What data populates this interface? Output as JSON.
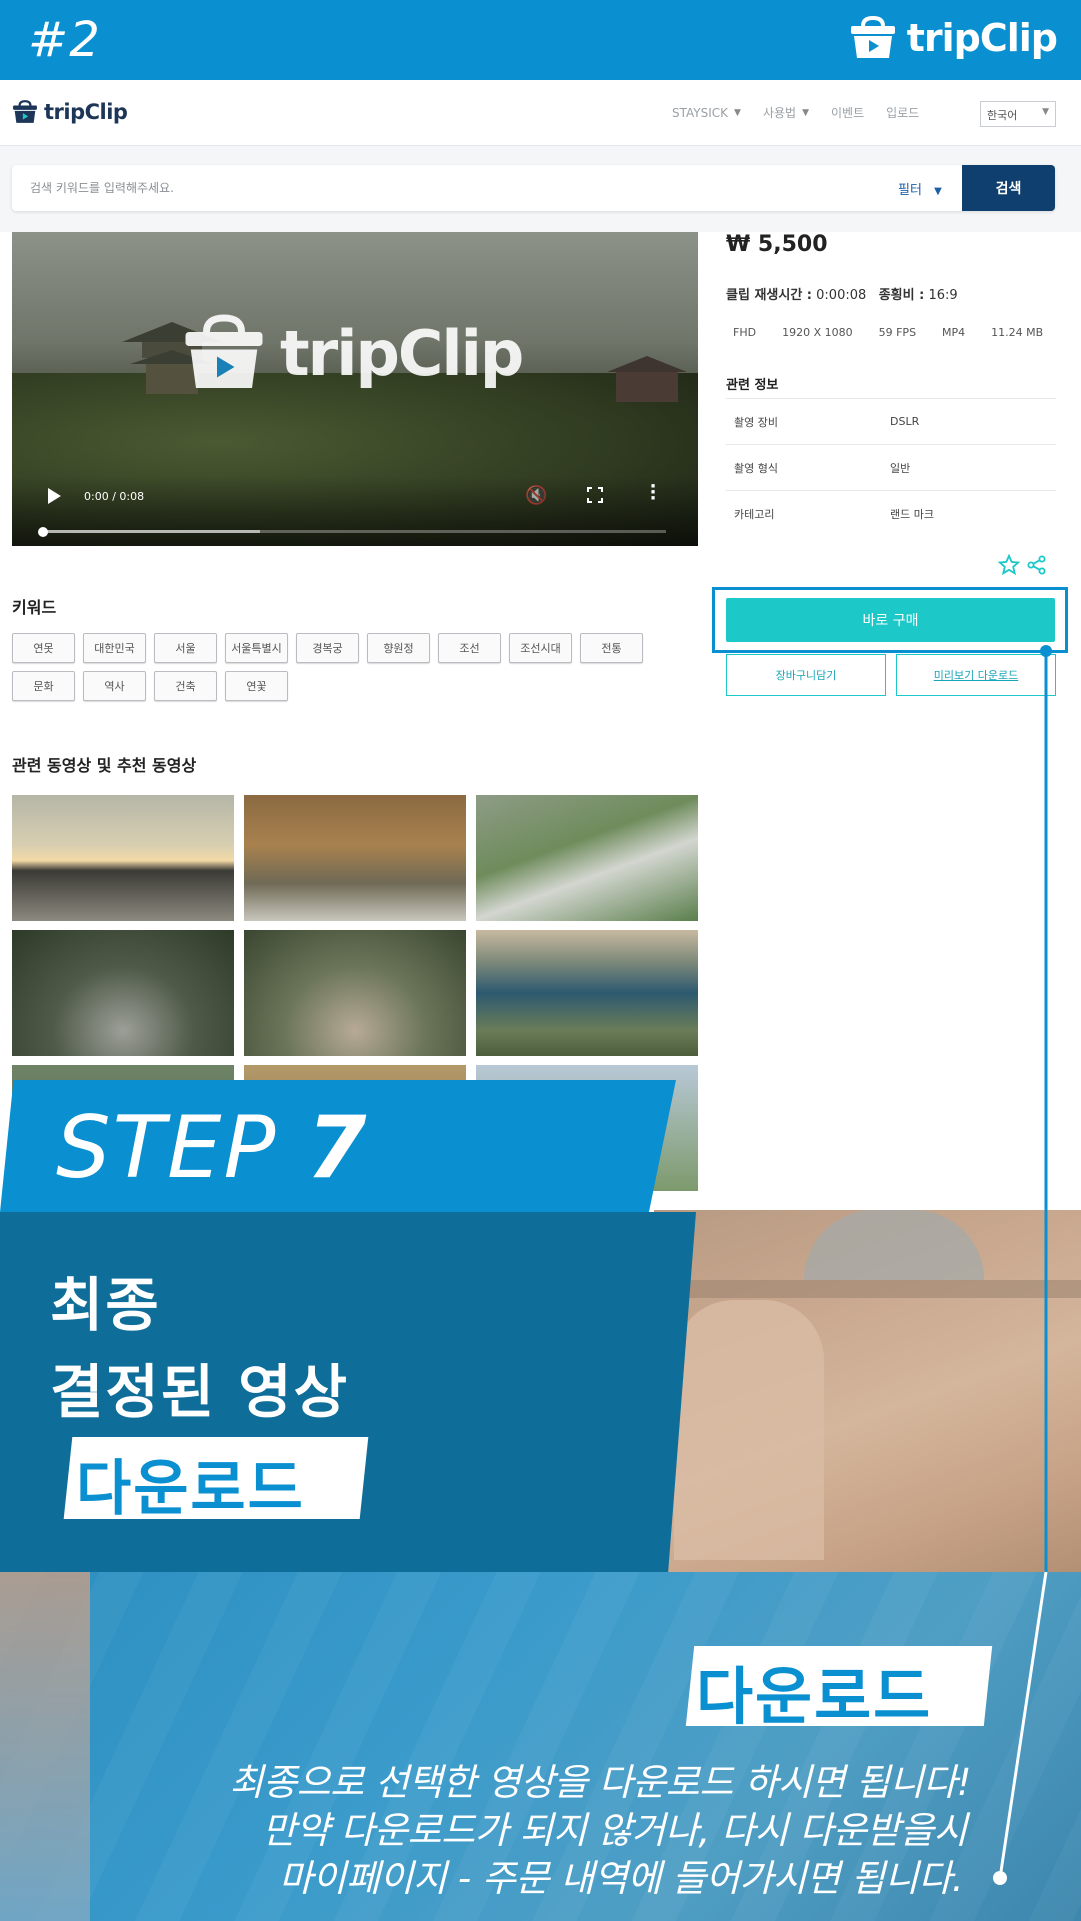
{
  "banner": {
    "step_label": "#2",
    "brand": "tripClip"
  },
  "header": {
    "brand": "tripClip",
    "nav": [
      "STAYSICK",
      "사용법",
      "이벤트",
      "입로드"
    ],
    "language": "한국어"
  },
  "search": {
    "placeholder": "검색 키워드를 입력해주세요.",
    "filter_label": "필터",
    "button_label": "검색"
  },
  "video": {
    "overlay_brand": "tripClip",
    "time": "0:00 / 0:08",
    "progress": 0.0,
    "buffered": 0.35
  },
  "product": {
    "price": "₩ 5,500",
    "duration_label": "클립 재생시간 :",
    "duration_value": "0:00:08",
    "ratio_label": "종횡비 :",
    "ratio_value": "16:9",
    "specs": [
      "FHD",
      "1920 X 1080",
      "59 FPS",
      "MP4",
      "11.24 MB"
    ],
    "related_title": "관련 정보",
    "info": [
      {
        "key": "촬영 장비",
        "value": "DSLR"
      },
      {
        "key": "촬영 형식",
        "value": "일반"
      },
      {
        "key": "카테고리",
        "value": "랜드 마크"
      }
    ],
    "buy_label": "바로 구매",
    "cart_label": "장바구니담기",
    "preview_label": "미리보기 다운로드"
  },
  "keywords": {
    "title": "키워드",
    "items": [
      "연못",
      "대한민국",
      "서울",
      "서울특별시",
      "경복궁",
      "향원정",
      "조선",
      "조선시대",
      "전통",
      "문화",
      "역사",
      "건축",
      "연꽃"
    ]
  },
  "related": {
    "title": "관련 동영상 및 추천 동영상"
  },
  "overlay": {
    "step_word": "STEP",
    "step_number": "7",
    "title_line1": "최종",
    "title_line2": "결정된 영상",
    "title_highlight": "다운로드",
    "download_badge": "다운로드",
    "desc_line1": "최종으로 선택한 영상을 다운로드 하시면 됩니다!",
    "desc_line2": "만약 다운로드가 되지 않거나, 다시 다운받을시",
    "desc_line3": "마이페이지 - 주문 내역에 들어가시면 됩니다."
  },
  "colors": {
    "brand_blue": "#0a8fd1",
    "dark_blue": "#0f6e99",
    "teal": "#1cc8c8",
    "navy": "#0f3f6e"
  }
}
